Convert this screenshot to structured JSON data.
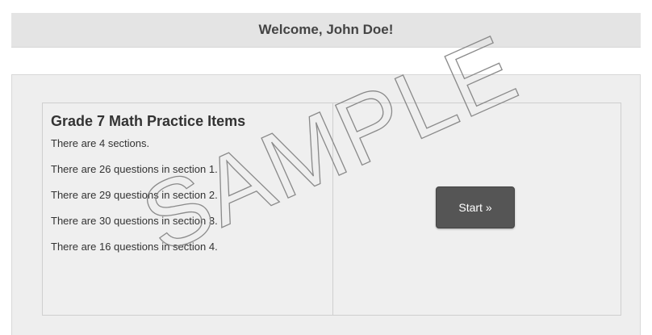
{
  "header": {
    "welcome": "Welcome, John Doe!"
  },
  "card": {
    "title": "Grade 7 Math Practice Items",
    "lines": [
      "There are 4 sections.",
      "There are 26 questions in section 1.",
      "There are 29 questions in section 2.",
      "There are 30 questions in section 3.",
      "There are 16 questions in section 4."
    ]
  },
  "start_button": {
    "label": "Start »"
  },
  "watermark": {
    "text": "SAMPLE"
  },
  "colors": {
    "header_bg": "#e4e4e4",
    "panel_bg": "#eeeeee",
    "button_bg": "#555555"
  }
}
